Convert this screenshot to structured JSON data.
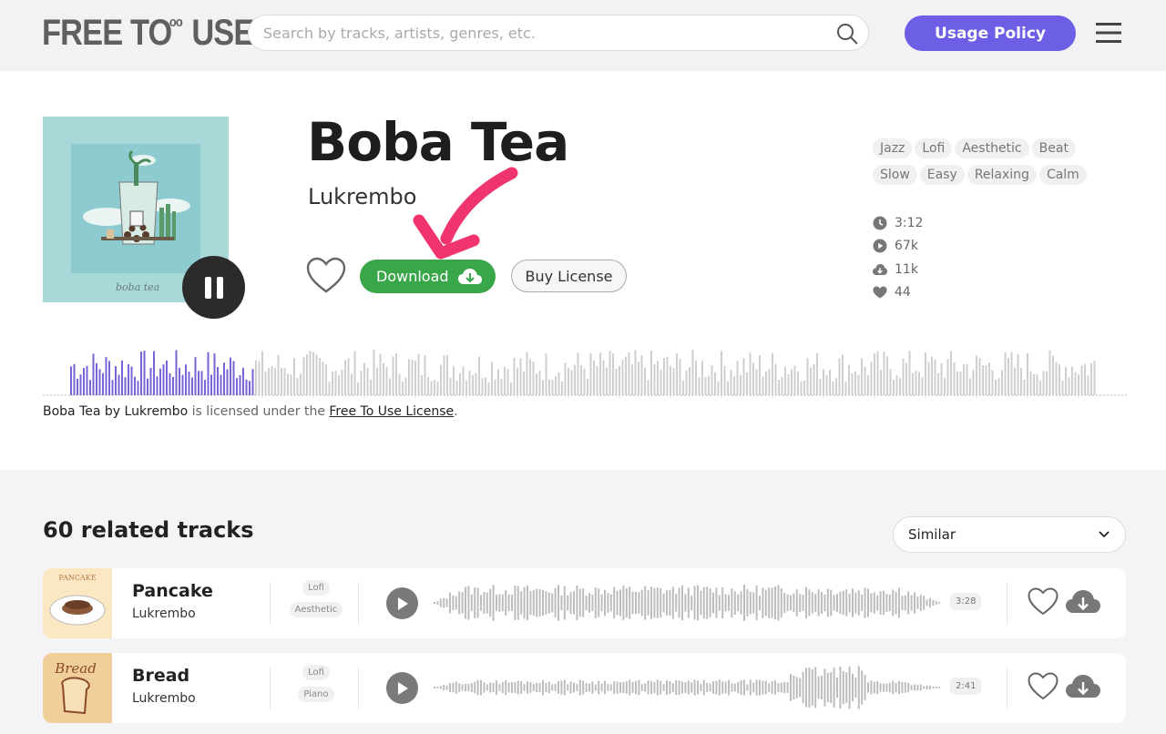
{
  "header": {
    "logo_text": "FREE TO",
    "logo_sup": "oo",
    "logo_tail": "USE",
    "search_placeholder": "Search by tracks, artists, genres, etc.",
    "usage_policy_label": "Usage Policy"
  },
  "track": {
    "title": "Boba Tea",
    "artist": "Lukrembo",
    "cover_text": "boba tea",
    "download_label": "Download",
    "buy_license_label": "Buy License",
    "tags": [
      "Jazz",
      "Lofi",
      "Aesthetic",
      "Beat",
      "Slow",
      "Easy",
      "Relaxing",
      "Calm"
    ],
    "stats": {
      "duration": "3:12",
      "plays": "67k",
      "downloads": "11k",
      "likes": "44"
    },
    "progress_fraction": 0.195,
    "license": {
      "subject": "Boba Tea by Lukrembo",
      "middle": " is licensed under the ",
      "link": "Free To Use License",
      "end": "."
    }
  },
  "related": {
    "title": "60 related tracks",
    "sort_value": "Similar",
    "tracks": [
      {
        "name": "Pancake",
        "artist": "Lukrembo",
        "tags": [
          "Lofi",
          "Aesthetic"
        ],
        "duration": "3:28",
        "thumb_text": "PANCAKE"
      },
      {
        "name": "Bread",
        "artist": "Lukrembo",
        "tags": [
          "Lofi",
          "Piano"
        ],
        "duration": "2:41",
        "thumb_text": "Bread"
      }
    ]
  },
  "colors": {
    "accent": "#6d5ee6",
    "download_green": "#3aa64a",
    "wave_played": "#7565d8",
    "wave_unplayed": "#cfcfd2",
    "arrow_pink": "#f0346e"
  },
  "icons": [
    "search-icon",
    "menu-icon",
    "pause-icon",
    "heart-icon",
    "cloud-download-icon",
    "clock-icon",
    "play-icon",
    "chevron-down-icon"
  ]
}
